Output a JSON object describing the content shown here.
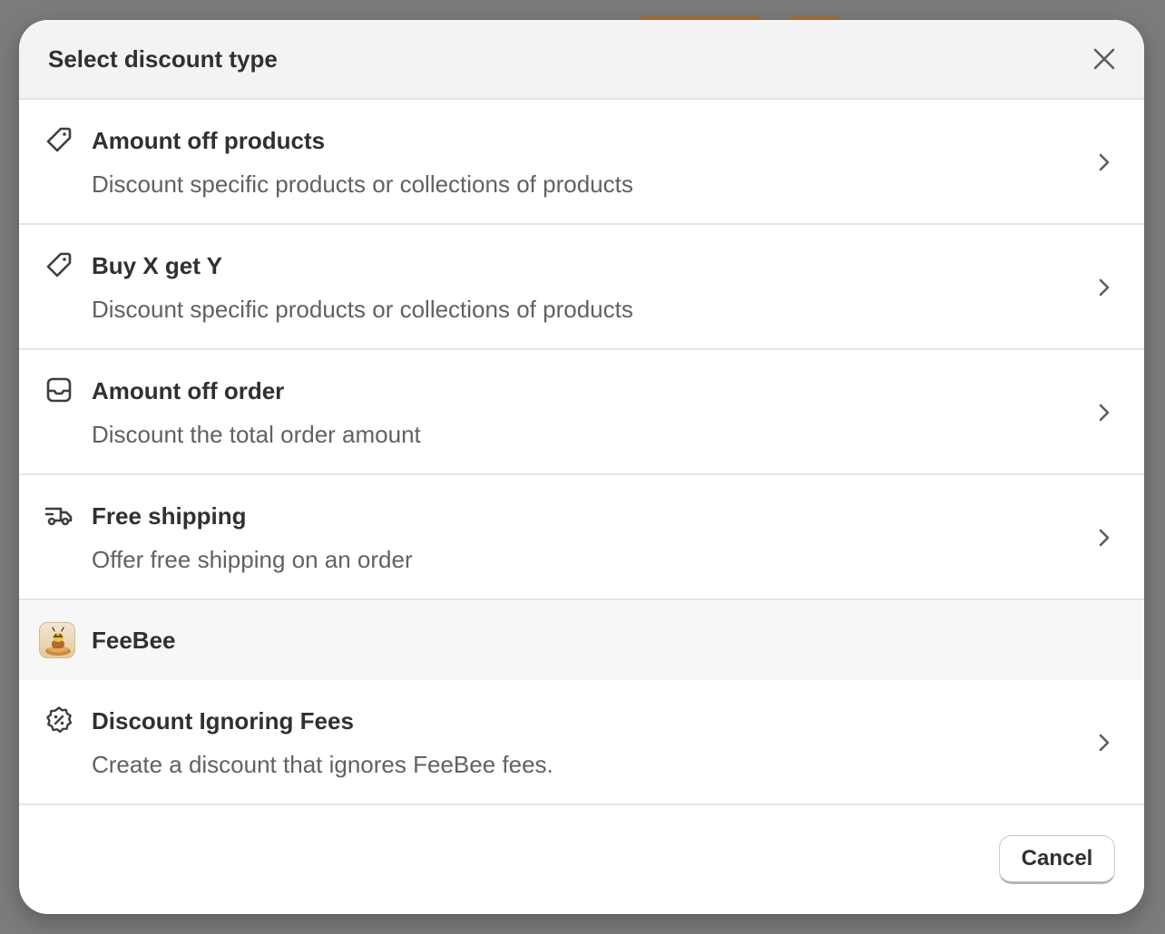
{
  "modal": {
    "title": "Select discount type",
    "close_icon": "close-icon"
  },
  "options": [
    {
      "title": "Amount off products",
      "description": "Discount specific products or collections of products",
      "icon": "tag-icon"
    },
    {
      "title": "Buy X get Y",
      "description": "Discount specific products or collections of products",
      "icon": "tag-icon"
    },
    {
      "title": "Amount off order",
      "description": "Discount the total order amount",
      "icon": "inbox-icon"
    },
    {
      "title": "Free shipping",
      "description": "Offer free shipping on an order",
      "icon": "delivery-truck-icon"
    }
  ],
  "app_section": {
    "name": "FeeBee",
    "icon": "feebee-app-logo"
  },
  "app_options": [
    {
      "title": "Discount Ignoring Fees",
      "description": "Create a discount that ignores FeeBee fees.",
      "icon": "discount-badge-icon"
    }
  ],
  "footer": {
    "cancel_label": "Cancel"
  },
  "colors": {
    "overlay": "#7b7b7b",
    "header_bg": "#f3f3f3",
    "title_text": "#303030",
    "description_text": "#616161",
    "divider": "#e3e3e3"
  }
}
